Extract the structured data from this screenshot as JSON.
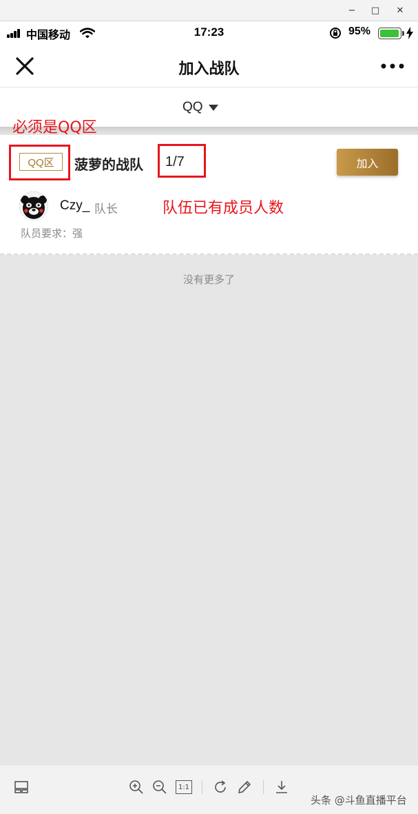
{
  "window": {
    "minimize_label": "−",
    "maximize_label": "□",
    "close_label": "✕"
  },
  "status_bar": {
    "carrier": "中国移动",
    "time": "17:23",
    "battery_percent": "95%",
    "battery_level": 0.95
  },
  "nav": {
    "title": "加入战队",
    "close_icon": "close-icon",
    "more_icon": "more-icon"
  },
  "filter": {
    "selected": "QQ"
  },
  "team": {
    "zone_tag": "QQ区",
    "name": "菠萝的战队",
    "count": "1/7",
    "join_label": "加入",
    "member_name": "Czy_",
    "member_role": "队长",
    "requirement": "队员要求：强"
  },
  "list_end": "没有更多了",
  "annotations": {
    "zone_note": "必须是QQ区",
    "count_note": "队伍已有成员人数",
    "color": "#e8141c"
  },
  "toolbar": {
    "watermark": "头条 @斗鱼直播平台",
    "icons": [
      "layout-icon",
      "zoom-in-icon",
      "zoom-out-icon",
      "actual-size-icon",
      "rotate-icon",
      "edit-icon",
      "download-icon"
    ],
    "actual_size_label": "1:1"
  },
  "colors": {
    "accent_gold": "#b48a3d",
    "join_button": "#b0823a",
    "battery_green": "#3cc13b"
  }
}
